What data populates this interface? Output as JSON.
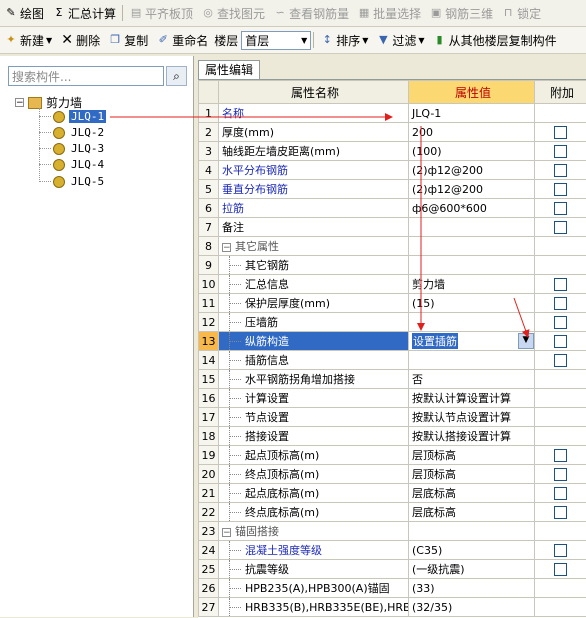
{
  "toolbar1": {
    "draw": "绘图",
    "sum_calc": "汇总计算",
    "align_top": "平齐板顶",
    "find_elem": "查找图元",
    "view_rebar": "查看钢筋量",
    "batch_select": "批量选择",
    "rebar_3d": "钢筋三维",
    "lock": "锁定"
  },
  "toolbar2": {
    "new": "新建",
    "delete": "删除",
    "copy": "复制",
    "rename": "重命名",
    "floor_label": "楼层",
    "floor_value": "首层",
    "sort": "排序",
    "filter": "过滤",
    "copy_from_floor": "从其他楼层复制构件"
  },
  "left": {
    "search_placeholder": "搜索构件...",
    "root": "剪力墙",
    "items": [
      "JLQ-1",
      "JLQ-2",
      "JLQ-3",
      "JLQ-4",
      "JLQ-5"
    ]
  },
  "right": {
    "tab": "属性编辑",
    "headers": {
      "name": "属性名称",
      "value": "属性值",
      "add": "附加"
    },
    "rows": [
      {
        "n": "1",
        "name": "名称",
        "value": "JLQ-1"
      },
      {
        "n": "2",
        "name": "厚度(mm)",
        "value": "200"
      },
      {
        "n": "3",
        "name": "轴线距左墙皮距离(mm)",
        "value": "(100)"
      },
      {
        "n": "4",
        "name": "水平分布钢筋",
        "value": "(2)ф12@200"
      },
      {
        "n": "5",
        "name": "垂直分布钢筋",
        "value": "(2)ф12@200"
      },
      {
        "n": "6",
        "name": "拉筋",
        "value": "ф6@600*600"
      },
      {
        "n": "7",
        "name": "备注",
        "value": ""
      },
      {
        "n": "8",
        "name": "其它属性",
        "value": ""
      },
      {
        "n": "9",
        "name": "其它钢筋",
        "value": ""
      },
      {
        "n": "10",
        "name": "汇总信息",
        "value": "剪力墙"
      },
      {
        "n": "11",
        "name": "保护层厚度(mm)",
        "value": "(15)"
      },
      {
        "n": "12",
        "name": "压墙筋",
        "value": ""
      },
      {
        "n": "13",
        "name": "纵筋构造",
        "value": "设置插筋"
      },
      {
        "n": "14",
        "name": "插筋信息",
        "value": ""
      },
      {
        "n": "15",
        "name": "水平钢筋拐角增加搭接",
        "value": "否"
      },
      {
        "n": "16",
        "name": "计算设置",
        "value": "按默认计算设置计算"
      },
      {
        "n": "17",
        "name": "节点设置",
        "value": "按默认节点设置计算"
      },
      {
        "n": "18",
        "name": "搭接设置",
        "value": "按默认搭接设置计算"
      },
      {
        "n": "19",
        "name": "起点顶标高(m)",
        "value": "层顶标高"
      },
      {
        "n": "20",
        "name": "终点顶标高(m)",
        "value": "层顶标高"
      },
      {
        "n": "21",
        "name": "起点底标高(m)",
        "value": "层底标高"
      },
      {
        "n": "22",
        "name": "终点底标高(m)",
        "value": "层底标高"
      },
      {
        "n": "23",
        "name": "锚固搭接",
        "value": ""
      },
      {
        "n": "24",
        "name": "混凝土强度等级",
        "value": "(C35)"
      },
      {
        "n": "25",
        "name": "抗震等级",
        "value": "(一级抗震)"
      },
      {
        "n": "26",
        "name": "HPB235(A),HPB300(A)锚固",
        "value": "(33)"
      },
      {
        "n": "27",
        "name": "HRB335(B),HRB335E(BE),HRBF",
        "value": "(32/35)"
      }
    ]
  },
  "colors": {
    "accent": "#316ac5",
    "header_value_bg": "#fcd872",
    "annotation_arrow": "#e0201c"
  }
}
